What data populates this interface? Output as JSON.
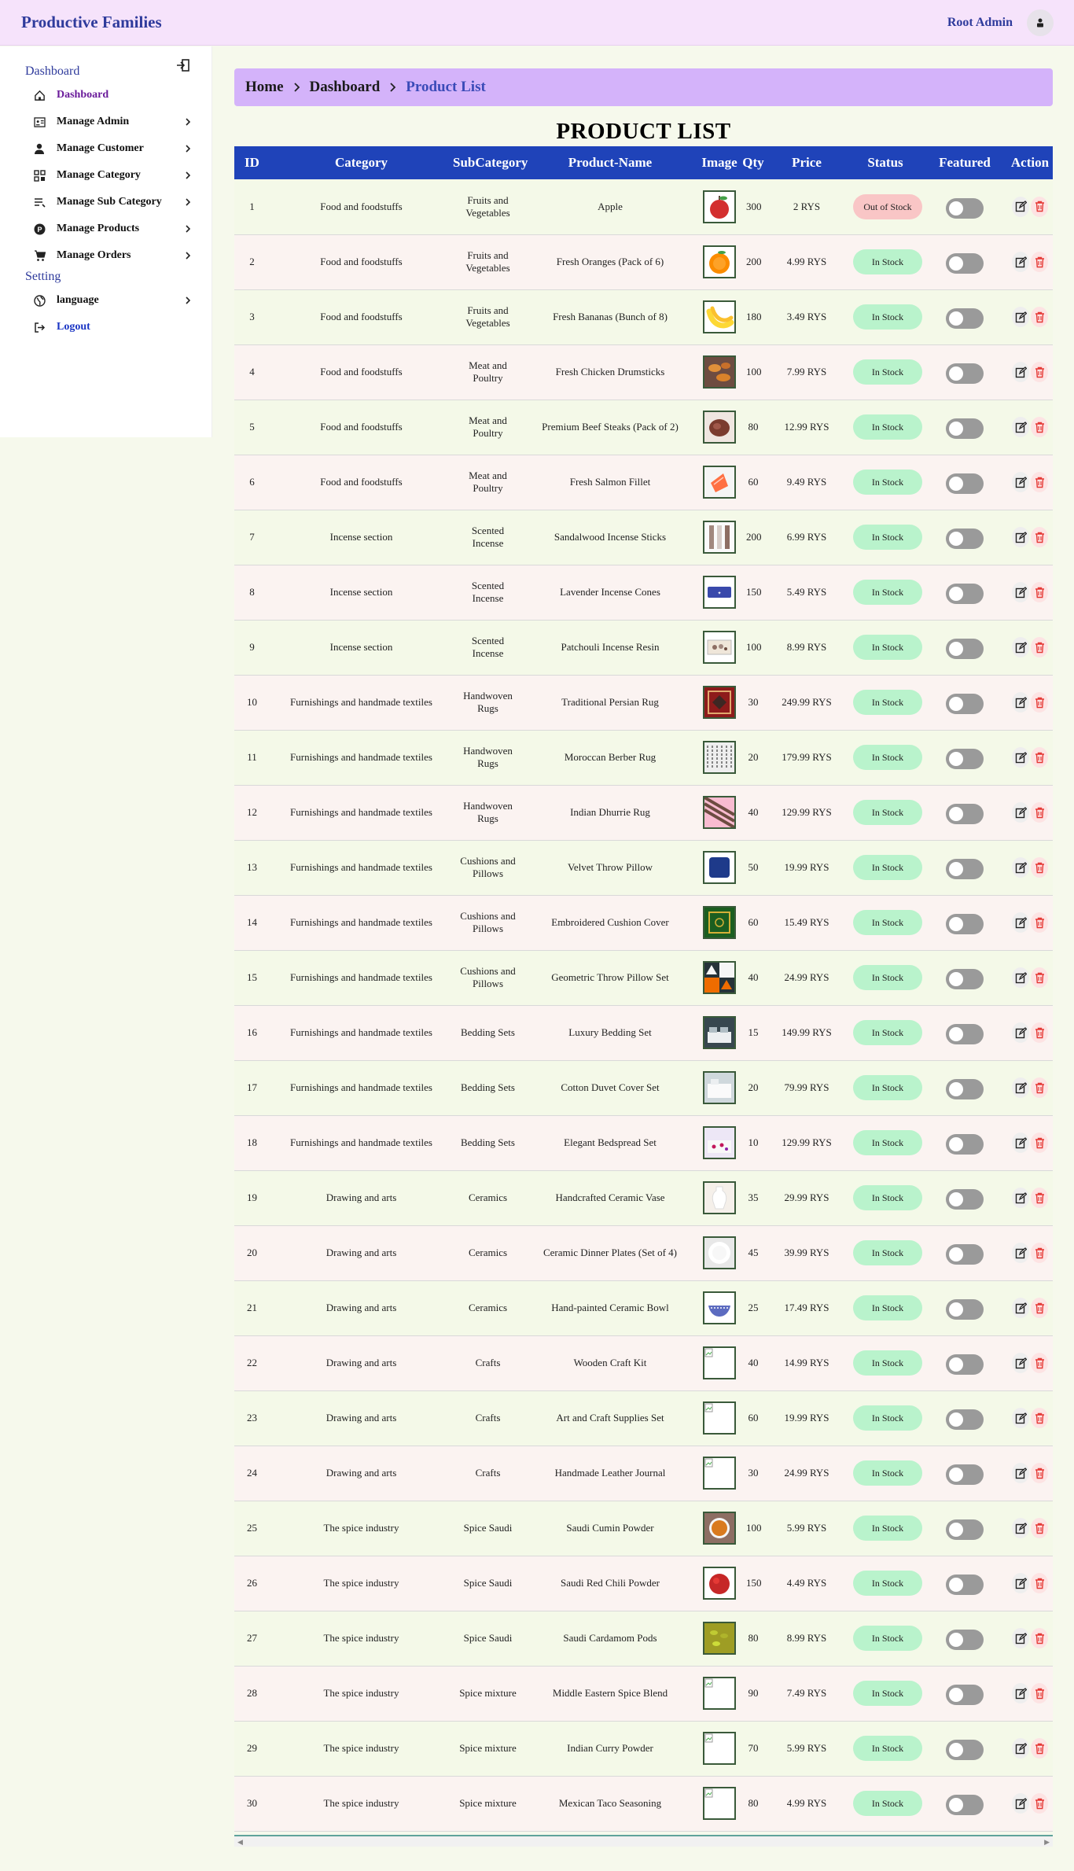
{
  "app": {
    "brand": "Productive Families",
    "user": "Root Admin"
  },
  "sidebar": {
    "dashboard_title": "Dashboard",
    "setting_title": "Setting",
    "items": [
      {
        "label": "Dashboard",
        "icon": "home-icon"
      },
      {
        "label": "Manage Admin",
        "icon": "id-card-icon"
      },
      {
        "label": "Manage Customer",
        "icon": "person-icon"
      },
      {
        "label": "Manage Category",
        "icon": "category-icon"
      },
      {
        "label": "Manage Sub Category",
        "icon": "list-icon"
      },
      {
        "label": "Manage Products",
        "icon": "product-icon"
      },
      {
        "label": "Manage Orders",
        "icon": "cart-icon"
      },
      {
        "label": "language",
        "icon": "globe-icon"
      },
      {
        "label": "Logout",
        "icon": "logout-icon"
      }
    ]
  },
  "breadcrumb": {
    "home": "Home",
    "dashboard": "Dashboard",
    "current": "Product List"
  },
  "page_title": "PRODUCT LIST",
  "table": {
    "columns": [
      "ID",
      "Category",
      "SubCategory",
      "Product-Name",
      "Image",
      "Qty",
      "Price",
      "Status",
      "Featured",
      "Action"
    ],
    "rows": [
      {
        "id": "1",
        "category": "Food and foodstuffs",
        "sub": "Fruits and Vegetables",
        "name": "Apple",
        "qty": "300",
        "price": "2 RYS",
        "status": "Out of Stock",
        "img": "apple"
      },
      {
        "id": "2",
        "category": "Food and foodstuffs",
        "sub": "Fruits and Vegetables",
        "name": "Fresh Oranges (Pack of 6)",
        "qty": "200",
        "price": "4.99 RYS",
        "status": "In Stock",
        "img": "orange"
      },
      {
        "id": "3",
        "category": "Food and foodstuffs",
        "sub": "Fruits and Vegetables",
        "name": "Fresh Bananas (Bunch of 8)",
        "qty": "180",
        "price": "3.49 RYS",
        "status": "In Stock",
        "img": "banana"
      },
      {
        "id": "4",
        "category": "Food and foodstuffs",
        "sub": "Meat and Poultry",
        "name": "Fresh Chicken Drumsticks",
        "qty": "100",
        "price": "7.99 RYS",
        "status": "In Stock",
        "img": "chicken"
      },
      {
        "id": "5",
        "category": "Food and foodstuffs",
        "sub": "Meat and Poultry",
        "name": "Premium Beef Steaks (Pack of 2)",
        "qty": "80",
        "price": "12.99 RYS",
        "status": "In Stock",
        "img": "beef"
      },
      {
        "id": "6",
        "category": "Food and foodstuffs",
        "sub": "Meat and Poultry",
        "name": "Fresh Salmon Fillet",
        "qty": "60",
        "price": "9.49 RYS",
        "status": "In Stock",
        "img": "salmon"
      },
      {
        "id": "7",
        "category": "Incense section",
        "sub": "Scented Incense",
        "name": "Sandalwood Incense Sticks",
        "qty": "200",
        "price": "6.99 RYS",
        "status": "In Stock",
        "img": "sticks"
      },
      {
        "id": "8",
        "category": "Incense section",
        "sub": "Scented Incense",
        "name": "Lavender Incense Cones",
        "qty": "150",
        "price": "5.49 RYS",
        "status": "In Stock",
        "img": "cones"
      },
      {
        "id": "9",
        "category": "Incense section",
        "sub": "Scented Incense",
        "name": "Patchouli Incense Resin",
        "qty": "100",
        "price": "8.99 RYS",
        "status": "In Stock",
        "img": "resin"
      },
      {
        "id": "10",
        "category": "Furnishings and handmade textiles",
        "sub": "Handwoven Rugs",
        "name": "Traditional Persian Rug",
        "qty": "30",
        "price": "249.99 RYS",
        "status": "In Stock",
        "img": "persian"
      },
      {
        "id": "11",
        "category": "Furnishings and handmade textiles",
        "sub": "Handwoven Rugs",
        "name": "Moroccan Berber Rug",
        "qty": "20",
        "price": "179.99 RYS",
        "status": "In Stock",
        "img": "berber"
      },
      {
        "id": "12",
        "category": "Furnishings and handmade textiles",
        "sub": "Handwoven Rugs",
        "name": "Indian Dhurrie Rug",
        "qty": "40",
        "price": "129.99 RYS",
        "status": "In Stock",
        "img": "dhurrie"
      },
      {
        "id": "13",
        "category": "Furnishings and handmade textiles",
        "sub": "Cushions and Pillows",
        "name": "Velvet Throw Pillow",
        "qty": "50",
        "price": "19.99 RYS",
        "status": "In Stock",
        "img": "velvet"
      },
      {
        "id": "14",
        "category": "Furnishings and handmade textiles",
        "sub": "Cushions and Pillows",
        "name": "Embroidered Cushion Cover",
        "qty": "60",
        "price": "15.49 RYS",
        "status": "In Stock",
        "img": "embroidered"
      },
      {
        "id": "15",
        "category": "Furnishings and handmade textiles",
        "sub": "Cushions and Pillows",
        "name": "Geometric Throw Pillow Set",
        "qty": "40",
        "price": "24.99 RYS",
        "status": "In Stock",
        "img": "geometric"
      },
      {
        "id": "16",
        "category": "Furnishings and handmade textiles",
        "sub": "Bedding Sets",
        "name": "Luxury Bedding Set",
        "qty": "15",
        "price": "149.99 RYS",
        "status": "In Stock",
        "img": "luxury"
      },
      {
        "id": "17",
        "category": "Furnishings and handmade textiles",
        "sub": "Bedding Sets",
        "name": "Cotton Duvet Cover Set",
        "qty": "20",
        "price": "79.99 RYS",
        "status": "In Stock",
        "img": "duvet"
      },
      {
        "id": "18",
        "category": "Furnishings and handmade textiles",
        "sub": "Bedding Sets",
        "name": "Elegant Bedspread Set",
        "qty": "10",
        "price": "129.99 RYS",
        "status": "In Stock",
        "img": "bedspread"
      },
      {
        "id": "19",
        "category": "Drawing and arts",
        "sub": "Ceramics",
        "name": "Handcrafted Ceramic Vase",
        "qty": "35",
        "price": "29.99 RYS",
        "status": "In Stock",
        "img": "vase"
      },
      {
        "id": "20",
        "category": "Drawing and arts",
        "sub": "Ceramics",
        "name": "Ceramic Dinner Plates (Set of 4)",
        "qty": "45",
        "price": "39.99 RYS",
        "status": "In Stock",
        "img": "plate"
      },
      {
        "id": "21",
        "category": "Drawing and arts",
        "sub": "Ceramics",
        "name": "Hand-painted Ceramic Bowl",
        "qty": "25",
        "price": "17.49 RYS",
        "status": "In Stock",
        "img": "bowl"
      },
      {
        "id": "22",
        "category": "Drawing and arts",
        "sub": "Crafts",
        "name": "Wooden Craft Kit",
        "qty": "40",
        "price": "14.99 RYS",
        "status": "In Stock",
        "img": "broken"
      },
      {
        "id": "23",
        "category": "Drawing and arts",
        "sub": "Crafts",
        "name": "Art and Craft Supplies Set",
        "qty": "60",
        "price": "19.99 RYS",
        "status": "In Stock",
        "img": "broken"
      },
      {
        "id": "24",
        "category": "Drawing and arts",
        "sub": "Crafts",
        "name": "Handmade Leather Journal",
        "qty": "30",
        "price": "24.99 RYS",
        "status": "In Stock",
        "img": "broken"
      },
      {
        "id": "25",
        "category": "The spice industry",
        "sub": "Spice Saudi",
        "name": "Saudi Cumin Powder",
        "qty": "100",
        "price": "5.99 RYS",
        "status": "In Stock",
        "img": "cumin"
      },
      {
        "id": "26",
        "category": "The spice industry",
        "sub": "Spice Saudi",
        "name": "Saudi Red Chili Powder",
        "qty": "150",
        "price": "4.49 RYS",
        "status": "In Stock",
        "img": "chili"
      },
      {
        "id": "27",
        "category": "The spice industry",
        "sub": "Spice Saudi",
        "name": "Saudi Cardamom Pods",
        "qty": "80",
        "price": "8.99 RYS",
        "status": "In Stock",
        "img": "cardamom"
      },
      {
        "id": "28",
        "category": "The spice industry",
        "sub": "Spice mixture",
        "name": "Middle Eastern Spice Blend",
        "qty": "90",
        "price": "7.49 RYS",
        "status": "In Stock",
        "img": "broken"
      },
      {
        "id": "29",
        "category": "The spice industry",
        "sub": "Spice mixture",
        "name": "Indian Curry Powder",
        "qty": "70",
        "price": "5.99 RYS",
        "status": "In Stock",
        "img": "broken"
      },
      {
        "id": "30",
        "category": "The spice industry",
        "sub": "Spice mixture",
        "name": "Mexican Taco Seasoning",
        "qty": "80",
        "price": "4.99 RYS",
        "status": "In Stock",
        "img": "broken"
      }
    ]
  },
  "colors": {
    "header_bg": "#1f43b9",
    "brand": "#2f3b9c",
    "in_stock": "#b9f3cc",
    "out_of_stock": "#f9c6c6",
    "delete": "#e53935"
  }
}
